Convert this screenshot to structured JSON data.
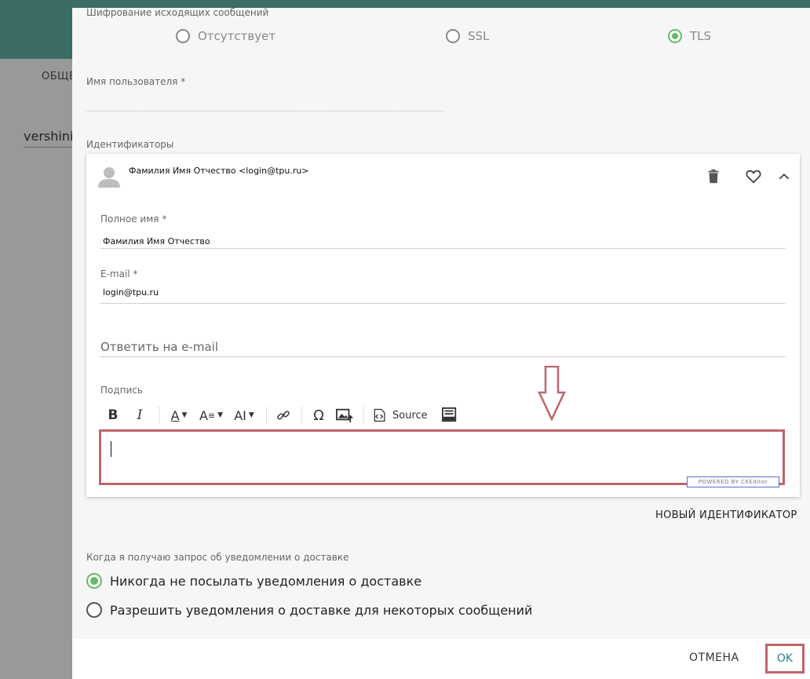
{
  "background": {
    "tab_label": "ОБЩЕ",
    "user_text": "vershinir"
  },
  "encryption": {
    "label": "Шифрование исходящих сообщений",
    "options": [
      {
        "label": "Отсутствует",
        "checked": false
      },
      {
        "label": "SSL",
        "checked": false
      },
      {
        "label": "TLS",
        "checked": true
      }
    ]
  },
  "username": {
    "label": "Имя пользователя",
    "required_mark": "*",
    "value": ""
  },
  "identities": {
    "label": "Идентификаторы",
    "card": {
      "title": "Фамилия Имя Отчество <login@tpu.ru>",
      "full_name": {
        "label": "Полное имя",
        "required_mark": "*",
        "value": "Фамилия Имя Отчество"
      },
      "email": {
        "label": "E-mail",
        "required_mark": "*",
        "value": "login@tpu.ru"
      },
      "reply_to": {
        "placeholder": "Ответить на e-mail"
      },
      "signature": {
        "label": "Подпись",
        "toolbar": {
          "bold": "B",
          "italic": "I",
          "font_color": "A",
          "font_size": "A",
          "font_family": "AI",
          "special_char": "Ω",
          "source_label": "Source"
        },
        "powered_by": "POWERED BY CKEditor"
      }
    },
    "new_identity_label": "НОВЫЙ ИДЕНТИФИКАТОР"
  },
  "receipts": {
    "label": "Когда я получаю запрос об уведомлении о доставке",
    "options": [
      {
        "label": "Никогда не посылать уведомления о доставке",
        "checked": true
      },
      {
        "label": "Разрешить уведомления о доставке для некоторых сообщений",
        "checked": false
      }
    ]
  },
  "footer": {
    "cancel_label": "ОТМЕНА",
    "ok_label": "OK"
  },
  "colors": {
    "accent_green": "#66bb6a",
    "header_teal": "#3d6b66",
    "highlight_red": "#c0646a"
  }
}
